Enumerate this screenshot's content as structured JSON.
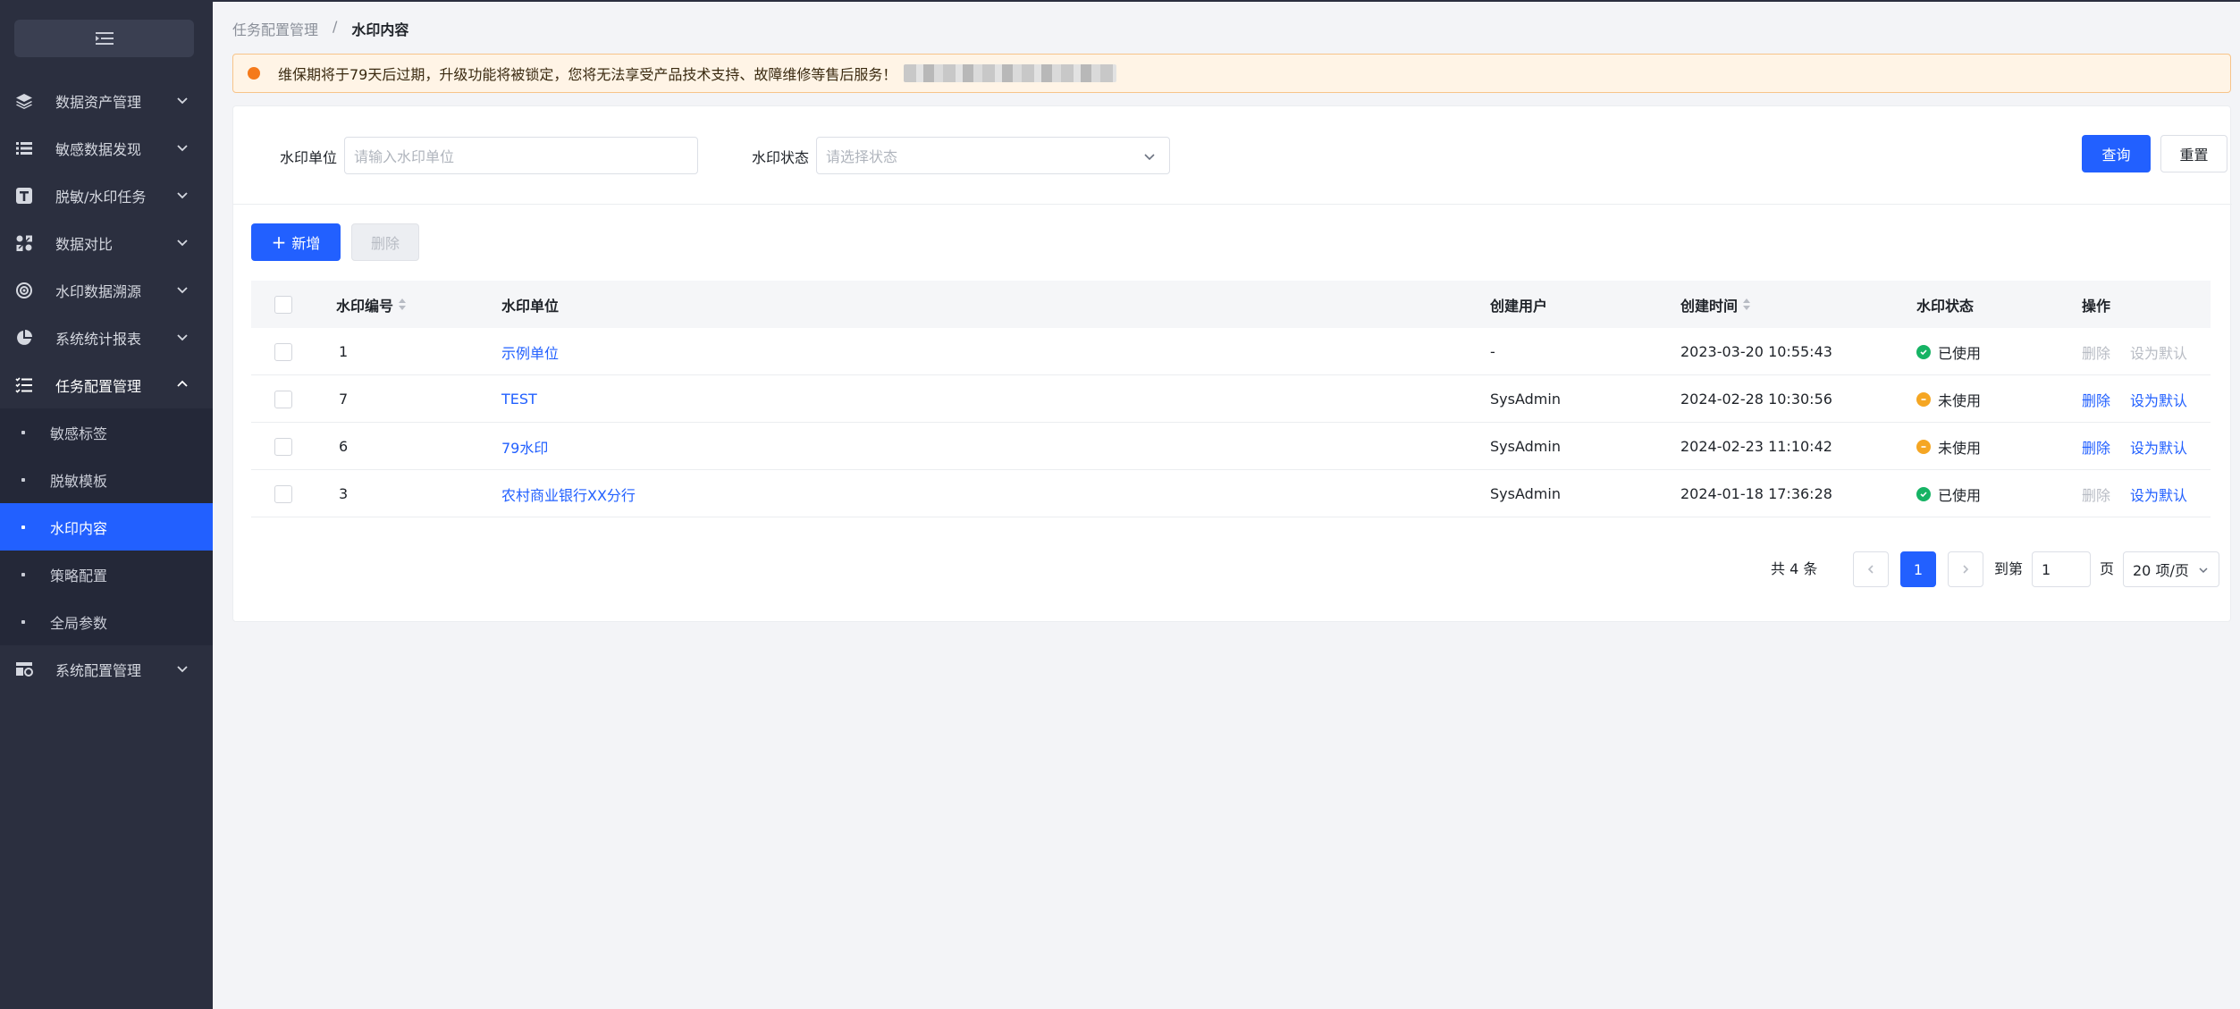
{
  "sidebar": {
    "items": [
      {
        "label": "数据资产管理",
        "icon": "layers-icon"
      },
      {
        "label": "敏感数据发现",
        "icon": "list-icon"
      },
      {
        "label": "脱敏/水印任务",
        "icon": "text-box-icon"
      },
      {
        "label": "数据对比",
        "icon": "compare-icon"
      },
      {
        "label": "水印数据溯源",
        "icon": "target-icon"
      },
      {
        "label": "系统统计报表",
        "icon": "pie-chart-icon"
      },
      {
        "label": "任务配置管理",
        "icon": "task-list-icon"
      }
    ],
    "subitems": [
      {
        "label": "敏感标签"
      },
      {
        "label": "脱敏模板"
      },
      {
        "label": "水印内容"
      },
      {
        "label": "策略配置"
      },
      {
        "label": "全局参数"
      }
    ],
    "last_item": {
      "label": "系统配置管理",
      "icon": "settings-panel-icon"
    }
  },
  "breadcrumb": {
    "parent": "任务配置管理",
    "separator": "/",
    "current": "水印内容"
  },
  "notice": {
    "text": "维保期将于79天后过期，升级功能将被锁定，您将无法享受产品技术支持、故障维修等售后服务！"
  },
  "filters": {
    "unit_label": "水印单位",
    "unit_placeholder": "请输入水印单位",
    "status_label": "水印状态",
    "status_placeholder": "请选择状态",
    "query_label": "查询",
    "reset_label": "重置"
  },
  "actions": {
    "add_label": "新增",
    "delete_label": "删除"
  },
  "table": {
    "headers": {
      "id": "水印编号",
      "unit": "水印单位",
      "user": "创建用户",
      "time": "创建时间",
      "status": "水印状态",
      "ops": "操作"
    },
    "rows": [
      {
        "id": "1",
        "unit": "示例单位",
        "user": "-",
        "time": "2023-03-20 10:55:43",
        "status": "已使用",
        "used": true,
        "op_delete": "删除",
        "op_default": "设为默认"
      },
      {
        "id": "7",
        "unit": "TEST",
        "user": "SysAdmin",
        "time": "2024-02-28 10:30:56",
        "status": "未使用",
        "used": false,
        "op_delete": "删除",
        "op_default": "设为默认"
      },
      {
        "id": "6",
        "unit": "79水印",
        "user": "SysAdmin",
        "time": "2024-02-23 11:10:42",
        "status": "未使用",
        "used": false,
        "op_delete": "删除",
        "op_default": "设为默认"
      },
      {
        "id": "3",
        "unit": "农村商业银行XX分行",
        "user": "SysAdmin",
        "time": "2024-01-18 17:36:28",
        "status": "已使用",
        "used": true,
        "op_delete": "删除",
        "op_default": "设为默认"
      }
    ]
  },
  "pagination": {
    "total": "共 4 条",
    "page": "1",
    "goto_label": "到第",
    "goto_value": "1",
    "page_unit": "页",
    "page_size": "20 项/页"
  },
  "colors": {
    "primary": "#2260ff",
    "success": "#16b364",
    "warning": "#f5a623",
    "sidebar": "#2b2f3f"
  }
}
